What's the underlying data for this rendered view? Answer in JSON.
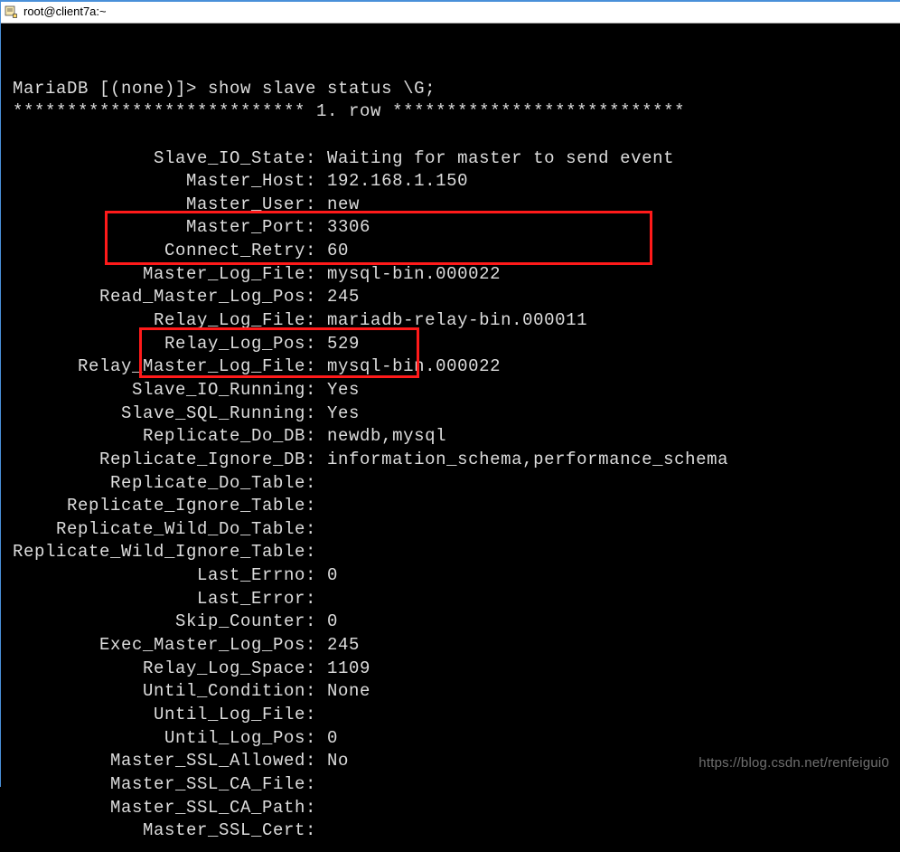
{
  "window": {
    "title": "root@client7a:~"
  },
  "prompt": "MariaDB [(none)]> show slave status \\G;",
  "row_header": "*************************** 1. row ***************************",
  "status": [
    {
      "label": "Slave_IO_State",
      "value": "Waiting for master to send event"
    },
    {
      "label": "Master_Host",
      "value": "192.168.1.150"
    },
    {
      "label": "Master_User",
      "value": "new"
    },
    {
      "label": "Master_Port",
      "value": "3306"
    },
    {
      "label": "Connect_Retry",
      "value": "60"
    },
    {
      "label": "Master_Log_File",
      "value": "mysql-bin.000022"
    },
    {
      "label": "Read_Master_Log_Pos",
      "value": "245"
    },
    {
      "label": "Relay_Log_File",
      "value": "mariadb-relay-bin.000011"
    },
    {
      "label": "Relay_Log_Pos",
      "value": "529"
    },
    {
      "label": "Relay_Master_Log_File",
      "value": "mysql-bin.000022"
    },
    {
      "label": "Slave_IO_Running",
      "value": "Yes"
    },
    {
      "label": "Slave_SQL_Running",
      "value": "Yes"
    },
    {
      "label": "Replicate_Do_DB",
      "value": "newdb,mysql"
    },
    {
      "label": "Replicate_Ignore_DB",
      "value": "information_schema,performance_schema"
    },
    {
      "label": "Replicate_Do_Table",
      "value": ""
    },
    {
      "label": "Replicate_Ignore_Table",
      "value": ""
    },
    {
      "label": "Replicate_Wild_Do_Table",
      "value": ""
    },
    {
      "label": "Replicate_Wild_Ignore_Table",
      "value": ""
    },
    {
      "label": "Last_Errno",
      "value": "0"
    },
    {
      "label": "Last_Error",
      "value": ""
    },
    {
      "label": "Skip_Counter",
      "value": "0"
    },
    {
      "label": "Exec_Master_Log_Pos",
      "value": "245"
    },
    {
      "label": "Relay_Log_Space",
      "value": "1109"
    },
    {
      "label": "Until_Condition",
      "value": "None"
    },
    {
      "label": "Until_Log_File",
      "value": ""
    },
    {
      "label": "Until_Log_Pos",
      "value": "0"
    },
    {
      "label": "Master_SSL_Allowed",
      "value": "No"
    },
    {
      "label": "Master_SSL_CA_File",
      "value": ""
    },
    {
      "label": "Master_SSL_CA_Path",
      "value": ""
    },
    {
      "label": "Master_SSL_Cert",
      "value": ""
    }
  ],
  "watermark": "https://blog.csdn.net/renfeigui0"
}
